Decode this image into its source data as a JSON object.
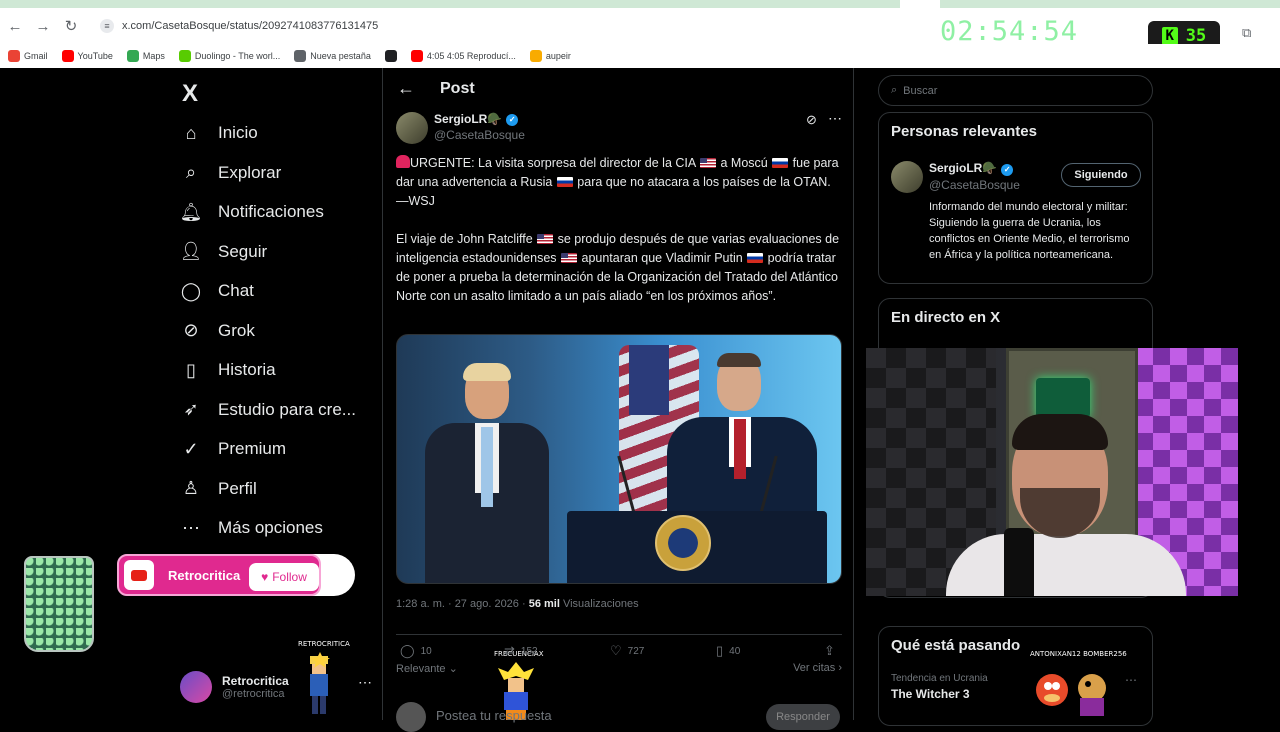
{
  "browser": {
    "url": "x.com/CasetaBosque/status/2092741083776131475",
    "timer": "02:54:54",
    "kick_count": "35",
    "bookmarks": [
      {
        "label": "Gmail",
        "color": "#ea4335"
      },
      {
        "label": "YouTube",
        "color": "#ff0000"
      },
      {
        "label": "Maps",
        "color": "#34a853"
      },
      {
        "label": "Duolingo - The worl...",
        "color": "#58cc02"
      },
      {
        "label": "Nueva pestaña",
        "color": "#5f6368"
      },
      {
        "label": "",
        "color": "#202124"
      },
      {
        "label": "4:05 4:05 Reproducí...",
        "color": "#ff0000"
      },
      {
        "label": "aupeir",
        "color": "#f9ab00"
      }
    ]
  },
  "sidebar": {
    "logo": "X",
    "items": [
      {
        "label": "Inicio",
        "icon": "home-icon",
        "glyph": "⌂"
      },
      {
        "label": "Explorar",
        "icon": "search-icon",
        "glyph": "⌕"
      },
      {
        "label": "Notificaciones",
        "icon": "bell-icon",
        "glyph": "🔔︎"
      },
      {
        "label": "Seguir",
        "icon": "follow-icon",
        "glyph": "👤︎"
      },
      {
        "label": "Chat",
        "icon": "chat-icon",
        "glyph": "◯"
      },
      {
        "label": "Grok",
        "icon": "grok-icon",
        "glyph": "⊘"
      },
      {
        "label": "Historia",
        "icon": "bookmark-icon",
        "glyph": "▯"
      },
      {
        "label": "Estudio para cre...",
        "icon": "rocket-icon",
        "glyph": "➶"
      },
      {
        "label": "Premium",
        "icon": "verified-icon",
        "glyph": "✓"
      },
      {
        "label": "Perfil",
        "icon": "profile-icon",
        "glyph": "♙"
      },
      {
        "label": "Más opciones",
        "icon": "more-icon",
        "glyph": "⋯"
      }
    ],
    "user": {
      "name": "Retrocritica",
      "handle": "@retrocritica"
    }
  },
  "overlay": {
    "channel_name": "Retrocritica",
    "follow_label": "Follow",
    "sprite_label_1": "RETROCRITICA",
    "sprite_label_2": "FRECUENCIAX",
    "sprite_label_3": "ANTONIXAN12 BOMBER256"
  },
  "main": {
    "header_title": "Post",
    "author": {
      "name": "SergioLR🪖",
      "handle": "@CasetaBosque"
    },
    "paragraph_1_a": "URGENTE: La visita sorpresa del director de la CIA ",
    "paragraph_1_b": " a Moscú ",
    "paragraph_1_c": " fue para dar una advertencia a Rusia ",
    "paragraph_1_d": " para que no atacara a los países de la OTAN.—WSJ",
    "paragraph_2_a": "El viaje de John Ratcliffe ",
    "paragraph_2_b": " se produjo después de que varias evaluaciones de inteligencia estadounidenses ",
    "paragraph_2_c": " apuntaran que Vladimir Putin ",
    "paragraph_2_d": " podría tratar de poner a prueba la determinación de la Organización del Tratado del Atlántico Norte con un asalto limitado a un país aliado “en los próximos años”.",
    "timestamp": "1:28 a. m. · 27 ago. 2026 · ",
    "views_count": "56 mil",
    "views_label": " Visualizaciones",
    "actions": {
      "replies": "10",
      "reposts": "152",
      "likes": "727",
      "bookmarks": "40"
    },
    "sort_label": "Relevante",
    "quotes_label": "Ver citas",
    "reply_placeholder": "Postea tu respuesta",
    "reply_button": "Responder"
  },
  "right": {
    "search_placeholder": "Buscar",
    "relevant_title": "Personas relevantes",
    "relevant_user": {
      "name": "SergioLR🪖",
      "handle": "@CasetaBosque",
      "follow_state": "Siguiendo",
      "bio": "Informando del mundo electoral y militar: Siguiendo la guerra de Ucrania, los conflictos en Oriente Medio, el terrorismo en África y la política norteamericana."
    },
    "live_title": "En directo en X",
    "trending_title": "Qué está pasando",
    "trend": {
      "context": "Tendencia en Ucrania",
      "name": "The Witcher 3"
    }
  }
}
